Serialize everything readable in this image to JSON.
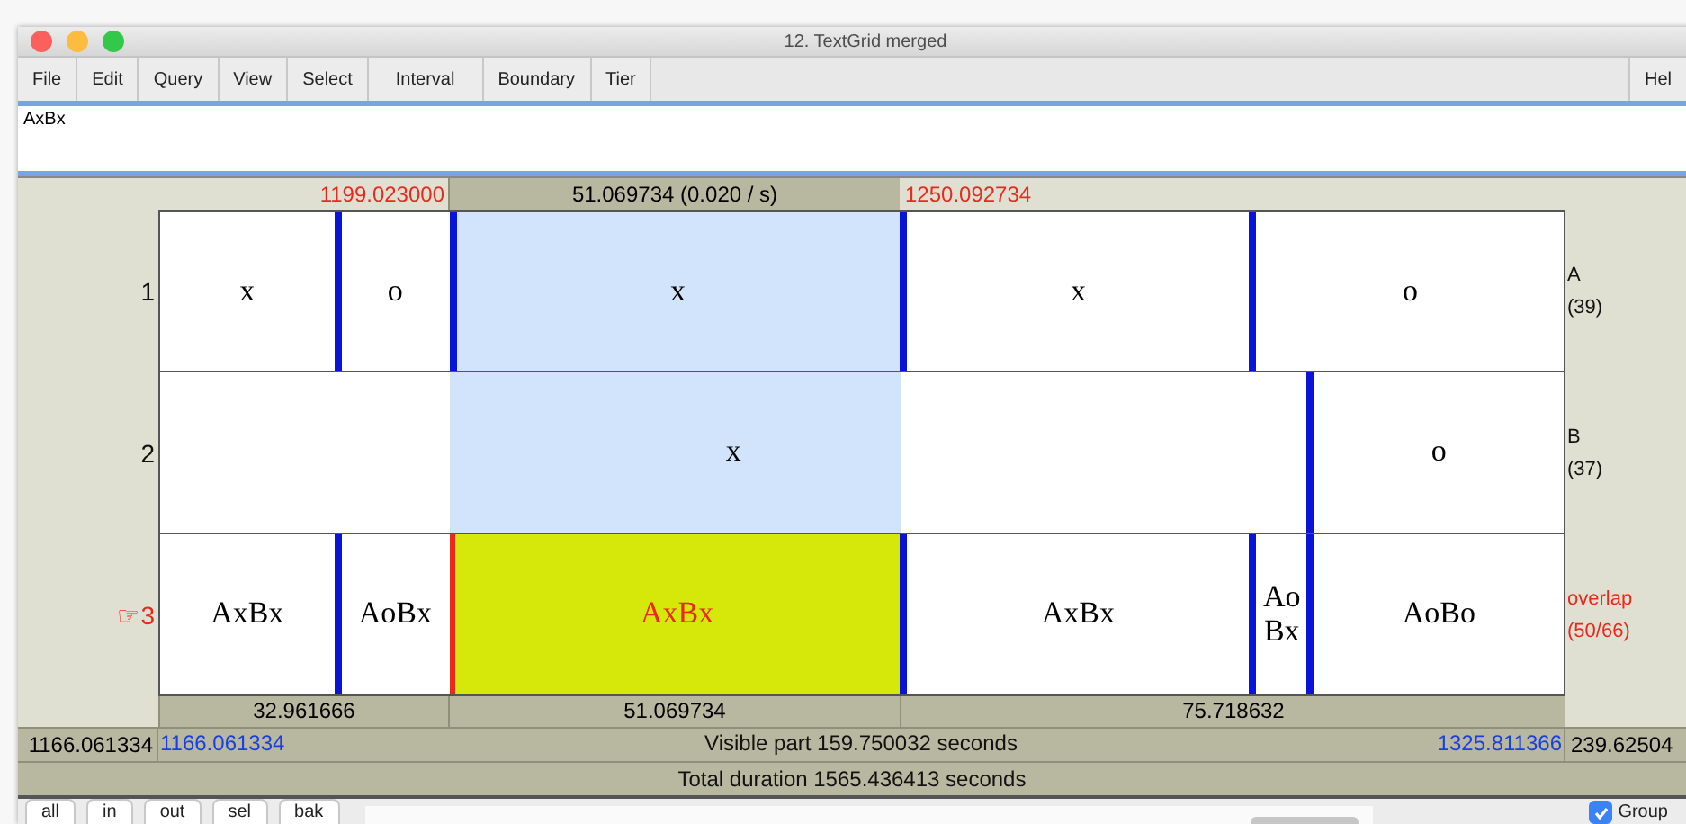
{
  "window": {
    "title": "12. TextGrid merged"
  },
  "menu": [
    "File",
    "Edit",
    "Query",
    "View",
    "Select",
    "Interval",
    "Boundary",
    "Tier"
  ],
  "menu_right": "Hel",
  "text_field": {
    "value": "AxBx"
  },
  "selection": {
    "start": "1199.023000",
    "duration": "51.069734 (0.020 / s)",
    "end": "1250.092734"
  },
  "tiers": [
    {
      "number": "1",
      "name": "A",
      "count": "(39)",
      "selected": false,
      "intervals": [
        {
          "text": "x",
          "selected": false
        },
        {
          "text": "o",
          "selected": false
        },
        {
          "text": "x",
          "selected": false
        },
        {
          "text": "x",
          "selected": false
        },
        {
          "text": "o",
          "selected": false
        }
      ]
    },
    {
      "number": "2",
      "name": "B",
      "count": "(37)",
      "selected": false,
      "intervals": [
        {
          "text": "x",
          "selected": false
        },
        {
          "text": "o",
          "selected": false
        }
      ]
    },
    {
      "number": "3",
      "pointer": "☞",
      "name": "overlap",
      "count": "(50/66)",
      "selected": true,
      "intervals": [
        {
          "text": "AxBx",
          "selected": false
        },
        {
          "text": "AoBx",
          "selected": false
        },
        {
          "text": "AxBx",
          "selected": true
        },
        {
          "text": "AxBx",
          "selected": false
        },
        {
          "text": "AoBx",
          "selected": false
        },
        {
          "text": "AoBo",
          "selected": false
        }
      ]
    }
  ],
  "durations": [
    "32.961666",
    "51.069734",
    "75.718632"
  ],
  "visible": {
    "window_start": "1166.061334",
    "start": "1166.061334",
    "label": "Visible part 159.750032 seconds",
    "end": "1325.811366",
    "after": "239.62504"
  },
  "total": "Total duration 1565.436413 seconds",
  "buttons": [
    "all",
    "in",
    "out",
    "sel",
    "bak"
  ],
  "group": {
    "label": "Group",
    "checked": true
  }
}
